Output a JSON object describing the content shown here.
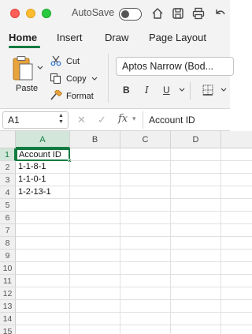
{
  "titlebar": {
    "autosave_label": "AutoSave",
    "autosave_on": false
  },
  "tabs": [
    "Home",
    "Insert",
    "Draw",
    "Page Layout"
  ],
  "active_tab": "Home",
  "clipboard": {
    "paste_label": "Paste",
    "cut_label": "Cut",
    "copy_label": "Copy",
    "format_label": "Format"
  },
  "font": {
    "name": "Aptos Narrow (Bod..."
  },
  "format_buttons": {
    "bold": "B",
    "italic": "I",
    "underline": "U"
  },
  "formula_bar": {
    "name_box": "A1",
    "fx_label": "fx",
    "formula": "Account ID"
  },
  "columns": [
    "A",
    "B",
    "C",
    "D"
  ],
  "rows": [
    "1",
    "2",
    "3",
    "4",
    "5",
    "6",
    "7",
    "8",
    "9",
    "10",
    "11",
    "12",
    "13",
    "14",
    "15"
  ],
  "cells": {
    "A1": "Account ID",
    "A2": "1-1-8-1",
    "A3": "1-1-0-1",
    "A4": "1-2-13-1"
  },
  "active_cell": "A1",
  "colors": {
    "accent": "#107c41",
    "chrome": "#f3f3f3"
  }
}
